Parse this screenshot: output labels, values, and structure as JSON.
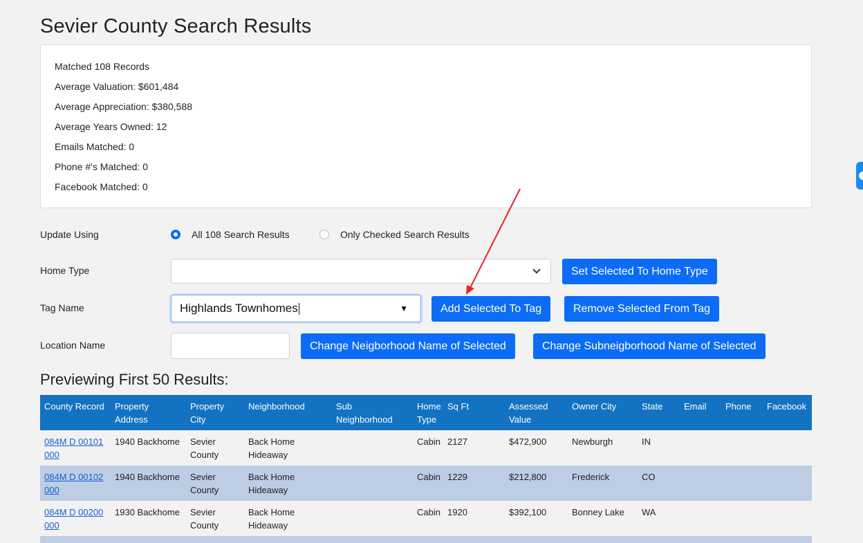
{
  "page": {
    "title": "Sevier County Search Results"
  },
  "stats": [
    "Matched 108 Records",
    "Average Valuation: $601,484",
    "Average Appreciation: $380,588",
    "Average Years Owned: 12",
    "Emails Matched: 0",
    "Phone #'s Matched: 0",
    "Facebook Matched: 0"
  ],
  "form": {
    "update_using_label": "Update Using",
    "radio_all": "All 108 Search Results",
    "radio_checked": "Only Checked Search Results",
    "home_type_label": "Home Type",
    "home_type_value": "",
    "set_home_type_button": "Set Selected To Home Type",
    "tag_name_label": "Tag Name",
    "tag_name_value": "Highlands Townhomes",
    "add_to_tag_button": "Add Selected To Tag",
    "remove_from_tag_button": "Remove Selected From Tag",
    "location_name_label": "Location Name",
    "location_name_value": "",
    "change_neighborhood_button": "Change Neigborhood Name of Selected",
    "change_subneighborhood_button": "Change Subneigborhood Name of Selected"
  },
  "preview": {
    "title": "Previewing First 50 Results:",
    "columns": [
      "County Record",
      "Property Address",
      "Property City",
      "Neighborhood",
      "Sub Neighborhood",
      "Home Type",
      "Sq Ft",
      "Assessed Value",
      "Owner City",
      "State",
      "Email",
      "Phone",
      "Facebook"
    ],
    "rows": [
      {
        "record": "084M D 00101 000",
        "address": "1940 Backhome",
        "city": "Sevier County",
        "neighborhood": "Back Home Hideaway",
        "sub": "",
        "home_type": "Cabin",
        "sqft": "2127",
        "value": "$472,900",
        "owner_city": "Newburgh",
        "state": "IN",
        "email": "",
        "phone": "",
        "facebook": ""
      },
      {
        "record": "084M D 00102 000",
        "address": "1940 Backhome",
        "city": "Sevier County",
        "neighborhood": "Back Home Hideaway",
        "sub": "",
        "home_type": "Cabin",
        "sqft": "1229",
        "value": "$212,800",
        "owner_city": "Frederick",
        "state": "CO",
        "email": "",
        "phone": "",
        "facebook": ""
      },
      {
        "record": "084M D 00200 000",
        "address": "1930 Backhome",
        "city": "Sevier County",
        "neighborhood": "Back Home Hideaway",
        "sub": "",
        "home_type": "Cabin",
        "sqft": "1920",
        "value": "$392,100",
        "owner_city": "Bonney Lake",
        "state": "WA",
        "email": "",
        "phone": "",
        "facebook": ""
      }
    ]
  },
  "colors": {
    "primary": "#0b6cf5",
    "table_header": "#1372c1",
    "row_alt": "#bccde4",
    "annotation": "#e8231f"
  }
}
